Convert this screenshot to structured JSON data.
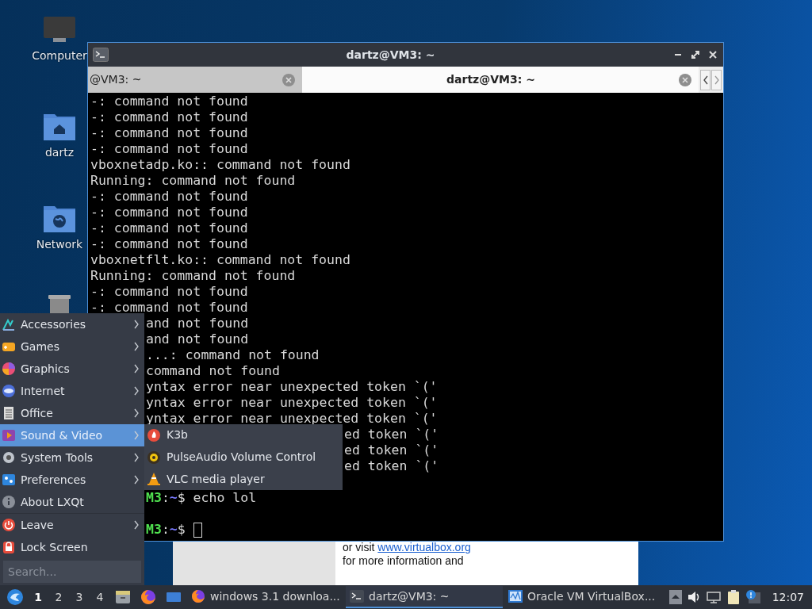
{
  "desktop_icons": [
    {
      "kind": "computer",
      "label": "Computer"
    },
    {
      "kind": "home_folder",
      "label": "dartz"
    },
    {
      "kind": "network_folder",
      "label": "Network"
    },
    {
      "kind": "trash"
    }
  ],
  "background_window": {
    "text_before": "or visit",
    "link": "www.virtualbox.org",
    "text_after": "for more information and"
  },
  "terminal": {
    "title": "dartz@VM3: ~",
    "tabs": [
      {
        "label": "@VM3: ~",
        "selected": false
      },
      {
        "label": "dartz@VM3: ~",
        "selected": true
      }
    ],
    "lines": [
      {
        "kind": "output",
        "text": "-: command not found"
      },
      {
        "kind": "output",
        "text": "-: command not found"
      },
      {
        "kind": "output",
        "text": "-: command not found"
      },
      {
        "kind": "output",
        "text": "-: command not found"
      },
      {
        "kind": "output",
        "text": "vboxnetadp.ko:: command not found"
      },
      {
        "kind": "output",
        "text": "Running: command not found"
      },
      {
        "kind": "output",
        "text": "-: command not found"
      },
      {
        "kind": "output",
        "text": "-: command not found"
      },
      {
        "kind": "output",
        "text": "-: command not found"
      },
      {
        "kind": "output",
        "text": "-: command not found"
      },
      {
        "kind": "output",
        "text": "vboxnetflt.ko:: command not found"
      },
      {
        "kind": "output",
        "text": "Running: command not found"
      },
      {
        "kind": "output",
        "text": "-: command not found"
      },
      {
        "kind": "output",
        "text": "-: command not found"
      },
      {
        "kind": "under_menu",
        "text": "and not found"
      },
      {
        "kind": "under_menu",
        "text": "and not found"
      },
      {
        "kind": "under_menu",
        "text": "...: command not found"
      },
      {
        "kind": "under_menu",
        "text": "command not found"
      },
      {
        "kind": "under_menu",
        "text": "yntax error near unexpected token `('"
      },
      {
        "kind": "under_menu",
        "text": "yntax error near unexpected token `('"
      },
      {
        "kind": "under_menu",
        "text": "yntax error near unexpected token `('"
      },
      {
        "kind": "under_submenu",
        "text": "ed token `('"
      },
      {
        "kind": "under_submenu",
        "text": "ed token `('"
      },
      {
        "kind": "under_submenu",
        "text": "ed token `('"
      },
      {
        "kind": "blank"
      },
      {
        "kind": "prompt",
        "host": "M3",
        "sep": ":",
        "path": "~",
        "symbol": "$",
        "command": "echo lol",
        "cursor": false
      },
      {
        "kind": "blank"
      },
      {
        "kind": "prompt",
        "host": "M3",
        "sep": ":",
        "path": "~",
        "symbol": "$",
        "cursor": true
      }
    ]
  },
  "menu": {
    "groups": [
      [
        {
          "kind": "accessories",
          "label": "Accessories",
          "submenu": true,
          "selected": false
        },
        {
          "kind": "games",
          "label": "Games",
          "submenu": true,
          "selected": false
        },
        {
          "kind": "graphics",
          "label": "Graphics",
          "submenu": true,
          "selected": false
        },
        {
          "kind": "internet",
          "label": "Internet",
          "submenu": true,
          "selected": false
        },
        {
          "kind": "office",
          "label": "Office",
          "submenu": true,
          "selected": false
        },
        {
          "kind": "sound_video",
          "label": "Sound & Video",
          "submenu": true,
          "selected": true
        },
        {
          "kind": "system_tools",
          "label": "System Tools",
          "submenu": true,
          "selected": false
        },
        {
          "kind": "preferences",
          "label": "Preferences",
          "submenu": true,
          "selected": false
        },
        {
          "kind": "about",
          "label": "About LXQt",
          "submenu": false,
          "selected": false
        }
      ],
      [
        {
          "kind": "leave",
          "label": "Leave",
          "submenu": true,
          "selected": false
        },
        {
          "kind": "lock",
          "label": "Lock Screen",
          "submenu": false,
          "selected": false
        }
      ]
    ],
    "search": {
      "placeholder": "Search..."
    }
  },
  "submenu": {
    "items": [
      {
        "kind": "k3b",
        "label": "K3b"
      },
      {
        "kind": "pulseaudio",
        "label": "PulseAudio Volume Control"
      },
      {
        "kind": "vlc",
        "label": "VLC media player"
      }
    ]
  },
  "taskbar": {
    "desktops": [
      {
        "label": "1",
        "selected": true
      },
      {
        "label": "2",
        "selected": false
      },
      {
        "label": "3",
        "selected": false
      },
      {
        "label": "4",
        "selected": false
      }
    ],
    "tasks": [
      {
        "kind": "firefox",
        "label": "windows 3.1 downloa...",
        "selected": false
      },
      {
        "kind": "terminal",
        "label": "dartz@VM3: ~",
        "selected": true
      },
      {
        "kind": "virtualbox",
        "label": "Oracle VM VirtualBox...",
        "selected": false
      }
    ],
    "clock": "12:07"
  }
}
